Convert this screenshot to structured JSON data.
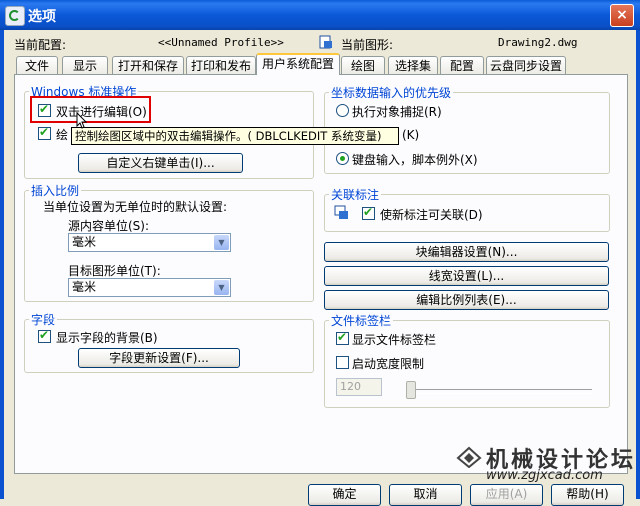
{
  "window": {
    "title": "选项",
    "close": "×"
  },
  "header": {
    "current_profile_label": "当前配置:",
    "current_profile_value": "<<Unnamed Profile>>",
    "current_drawing_label": "当前图形:",
    "current_drawing_value": "Drawing2.dwg"
  },
  "tabs": [
    "文件",
    "显示",
    "打开和保存",
    "打印和发布",
    "用户系统配置",
    "绘图",
    "选择集",
    "配置",
    "云盘同步设置"
  ],
  "windows_ops": {
    "legend": "Windows 标准操作",
    "double_click_edit": "双击进行编辑(O)",
    "shortcut_menu_partial": "绘",
    "shortcut_key_partial": "(K)",
    "custom_right_click_button": "自定义右键单击(I)...",
    "tooltip": "控制绘图区域中的双击编辑操作。( DBLCLKEDIT 系统变量)"
  },
  "insert_scale": {
    "legend": "插入比例",
    "desc": "当单位设置为无单位时的默认设置:",
    "source_label": "源内容单位(S):",
    "source_value": "毫米",
    "target_label": "目标图形单位(T):",
    "target_value": "毫米"
  },
  "fields": {
    "legend": "字段",
    "show_background": "显示字段的背景(B)",
    "update_settings_button": "字段更新设置(F)..."
  },
  "coord_priority": {
    "legend": "坐标数据输入的优先级",
    "option1": "执行对象捕捉(R)",
    "option2": "键盘输入，脚本例外(X)"
  },
  "assoc_dim": {
    "legend": "关联标注",
    "make_associative": "使新标注可关联(D)"
  },
  "buttons": {
    "block_editor": "块编辑器设置(N)...",
    "lineweight": "线宽设置(L)...",
    "scale_list": "编辑比例列表(E)..."
  },
  "file_tab": {
    "legend": "文件标签栏",
    "show_file_tabs": "显示文件标签栏",
    "enable_width_limit": "启动宽度限制",
    "width_value": "120"
  },
  "footer": {
    "ok": "确定",
    "cancel": "取消",
    "apply": "应用(A)",
    "help": "帮助(H)"
  },
  "watermark": {
    "text": "机械设计论坛",
    "url": "www.zgjxcad.com"
  },
  "state": {
    "double_click_edit": true,
    "shortcut_menu": true,
    "coord_option_selected": 2,
    "show_field_background": true,
    "associative_dim": true,
    "show_file_tabs": true,
    "width_limit": false,
    "width_slider_fraction": 0
  },
  "colors": {
    "titlebar": "#0a5bd8",
    "legend_text": "#0046d5",
    "highlight_box": "#e00000",
    "active_tab_accent": "#ffc83c"
  }
}
